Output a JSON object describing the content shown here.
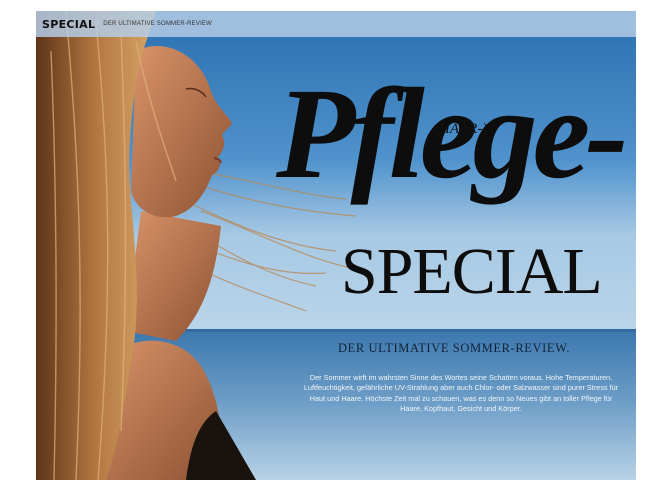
{
  "header": {
    "section": "SPECIAL",
    "subtitle": "DER ULTIMATIVE SOMMER-REVIEW"
  },
  "title": {
    "kicker": "(HAAR-)",
    "main": "Pflege-",
    "sub": "SPECIAL"
  },
  "deck": "DER ULTIMATIVE SOMMER-REVIEW.",
  "body": "Der Sommer wirft im wahrsten Sinne des Wortes seine Schatten voraus. Hohe Temperaturen, Luftfeuchtigkeit, gefährliche UV-Strahlung aber auch Chlor- oder Salzwasser sind purer Stress für Haut und Haare. Höchste Zeit mal zu schauen, was es denn so Neues gibt an toller Pflege für Haare, Kopfhaut, Gesicht und Körper.",
  "colors": {
    "sky_top": "#2a72b5",
    "sky_bottom": "#9cc3e2",
    "sea": "#3c78b0",
    "hair": "#a46a38",
    "skin": "#c07a52",
    "text_dark": "#0d0d0d"
  }
}
